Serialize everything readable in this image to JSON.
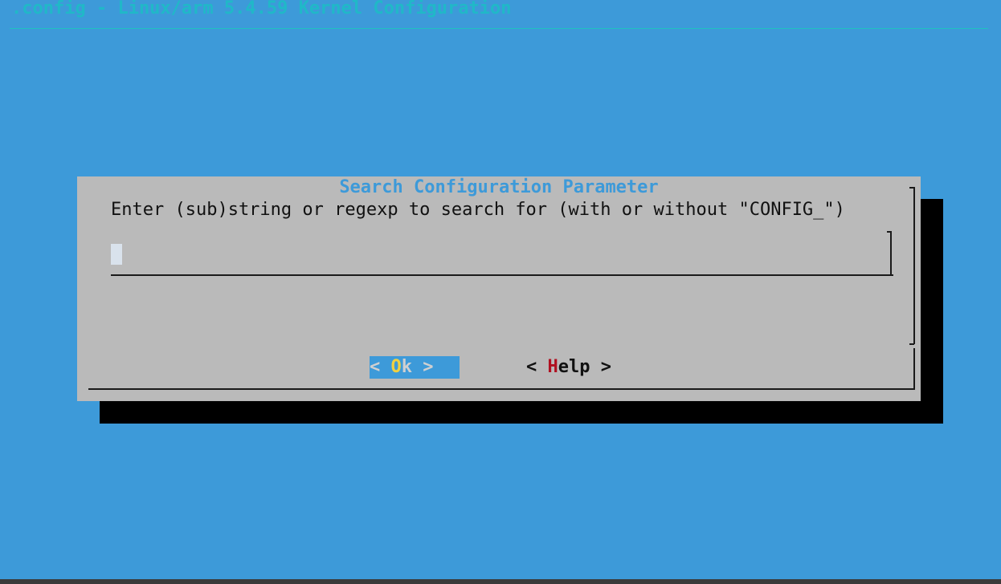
{
  "window": {
    "title": ".config - Linux/arm 5.4.59 Kernel Configuration"
  },
  "dialog": {
    "title": "Search Configuration Parameter",
    "prompt": "Enter (sub)string or regexp to search for (with or without \"CONFIG_\")",
    "input_value": "",
    "buttons": {
      "ok": {
        "open": "< ",
        "hotkey": "O",
        "rest": "k",
        "close": " >"
      },
      "help": {
        "open": "< ",
        "hotkey": "H",
        "rest": "elp",
        "close": " >"
      }
    }
  },
  "colors": {
    "background": "#3d9ad9",
    "dialog": "#bababa",
    "title": "#20b8c8",
    "hotkey_selected": "#f0d040",
    "hotkey": "#b01020"
  }
}
